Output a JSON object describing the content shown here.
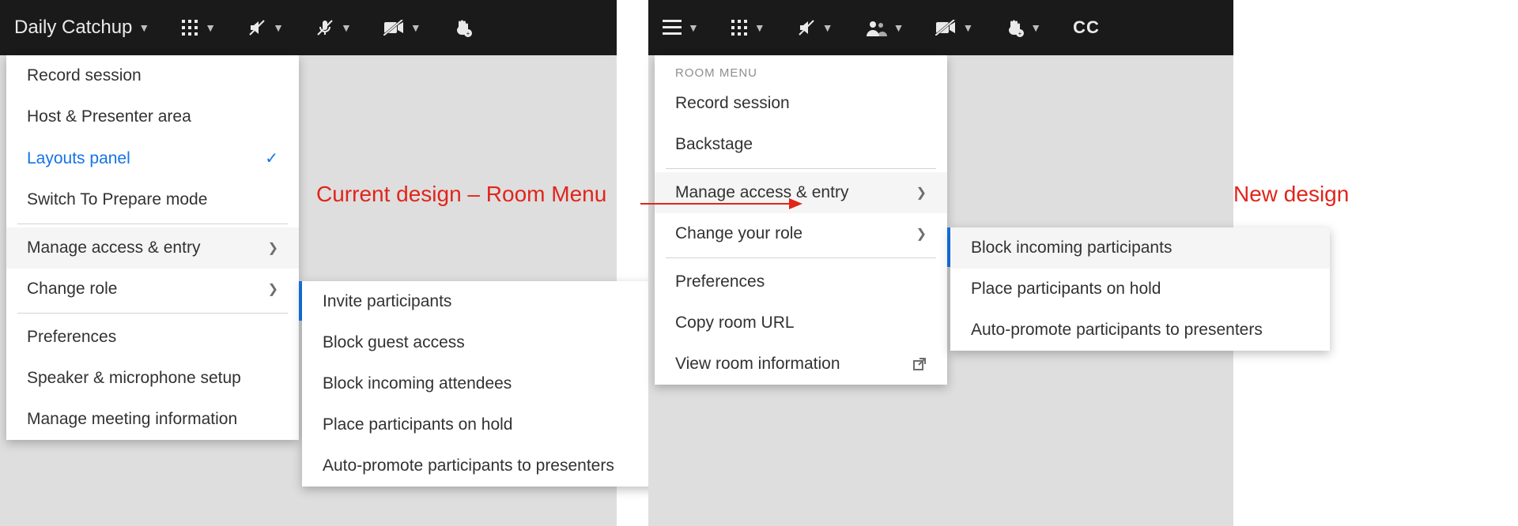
{
  "left": {
    "room_name": "Daily Catchup",
    "menu": {
      "record": "Record session",
      "host_area": "Host & Presenter area",
      "layouts": "Layouts panel",
      "prepare": "Switch To Prepare mode",
      "manage_access": "Manage access & entry",
      "change_role": "Change role",
      "preferences": "Preferences",
      "speaker_setup": "Speaker & microphone setup",
      "manage_info": "Manage meeting information"
    },
    "submenu": {
      "invite": "Invite participants",
      "block_guest": "Block guest access",
      "block_incoming": "Block incoming attendees",
      "hold": "Place participants on hold",
      "auto_promote": "Auto-promote participants to presenters"
    }
  },
  "right": {
    "cc": "CC",
    "menu_header": "ROOM MENU",
    "menu": {
      "record": "Record session",
      "backstage": "Backstage",
      "manage_access": "Manage access & entry",
      "change_role": "Change your role",
      "preferences": "Preferences",
      "copy_url": "Copy room URL",
      "view_info": "View room information"
    },
    "submenu": {
      "block_incoming": "Block incoming participants",
      "hold": "Place participants on hold",
      "auto_promote": "Auto-promote participants to presenters"
    }
  },
  "annotations": {
    "current": "Current design – Room Menu",
    "new": "New design"
  }
}
